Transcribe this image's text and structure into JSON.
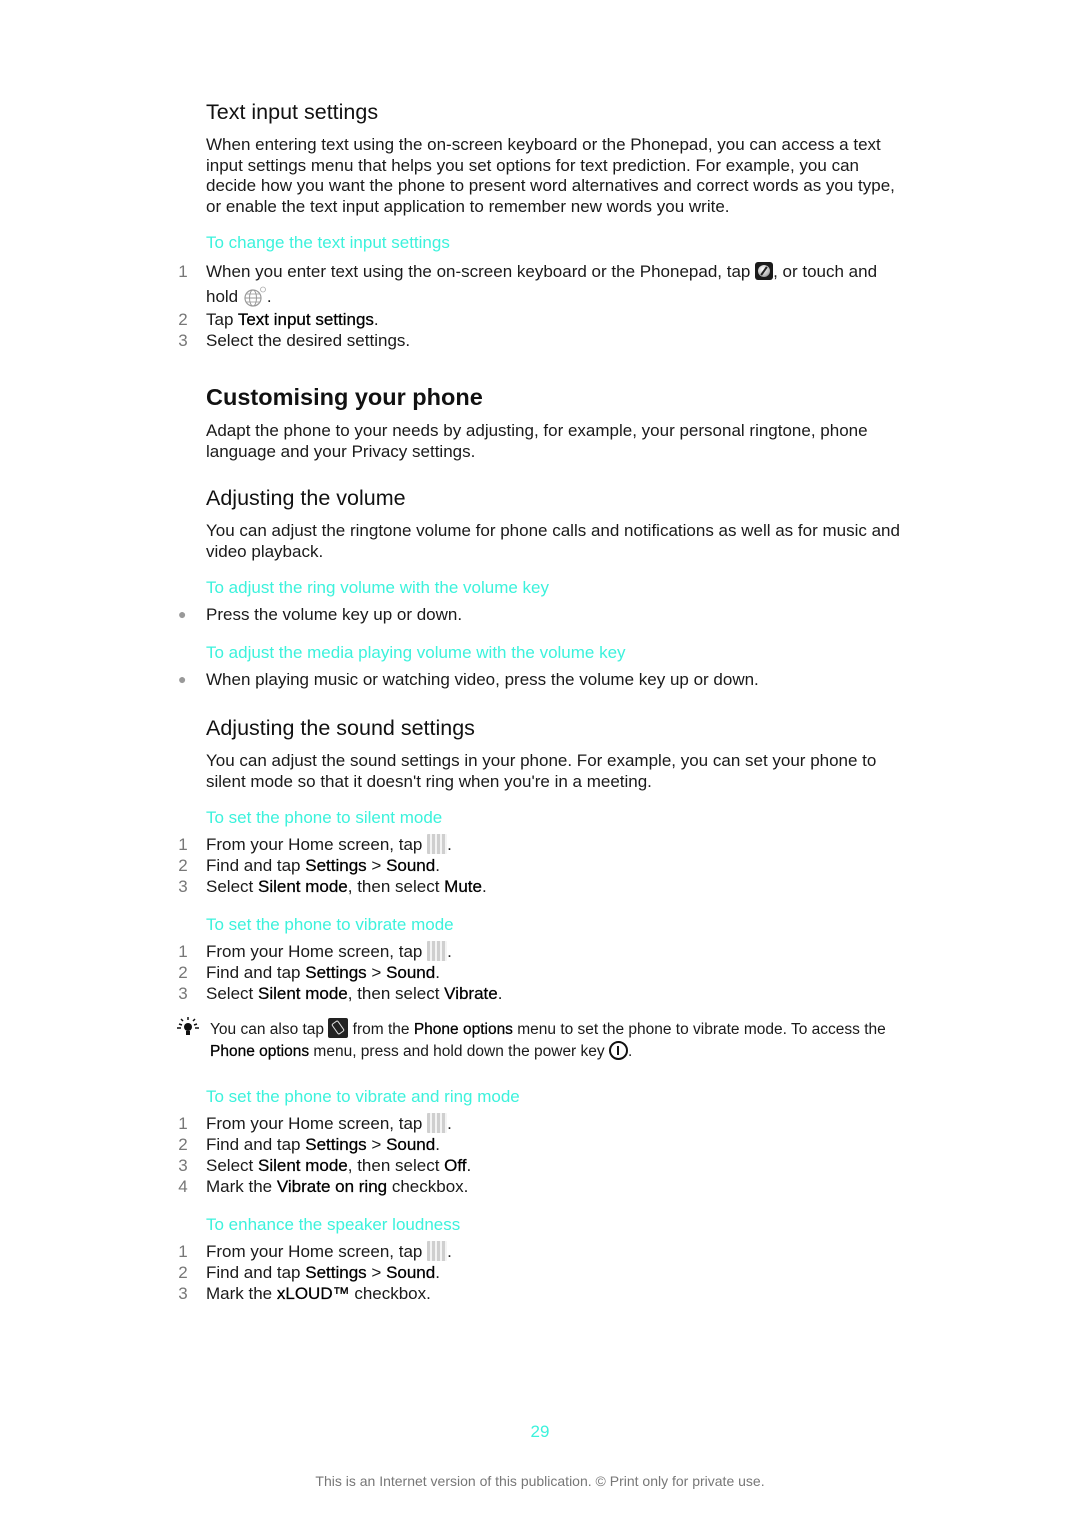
{
  "colors": {
    "task_heading": "#3cf2dc",
    "body_text": "#1a1a1a",
    "step_number": "#777777",
    "footer": "#777777"
  },
  "sections": {
    "text_input": {
      "heading": "Text input settings",
      "body": "When entering text using the on-screen keyboard or the Phonepad, you can access a text input settings menu that helps you set options for text prediction. For example, you can decide how you want the phone to present word alternatives and correct words as you type, or enable the text input application to remember new words you write.",
      "task": {
        "title": "To change the text input settings",
        "steps": [
          {
            "num": "1",
            "parts": [
              {
                "t": "When you enter text using the on-screen keyboard or the Phonepad, tap "
              },
              {
                "icon": "settings-wrench-icon"
              },
              {
                "t": ", or touch and hold "
              },
              {
                "icon": "globe-language-icon"
              },
              {
                "t": "."
              }
            ]
          },
          {
            "num": "2",
            "parts": [
              {
                "t": "Tap "
              },
              {
                "b": "Text input settings"
              },
              {
                "t": "."
              }
            ]
          },
          {
            "num": "3",
            "parts": [
              {
                "t": "Select the desired settings."
              }
            ]
          }
        ]
      }
    },
    "customising": {
      "heading": "Customising your phone",
      "body": "Adapt the phone to your needs by adjusting, for example, your personal ringtone, phone language and your Privacy settings."
    },
    "volume": {
      "heading": "Adjusting the volume",
      "body": "You can adjust the ringtone volume for phone calls and notifications as well as for music and video playback.",
      "tasks": [
        {
          "title": "To adjust the ring volume with the volume key",
          "bullets": [
            "Press the volume key up or down."
          ]
        },
        {
          "title": "To adjust the media playing volume with the volume key",
          "bullets": [
            "When playing music or watching video, press the volume key up or down."
          ]
        }
      ]
    },
    "sound": {
      "heading": "Adjusting the sound settings",
      "body": "You can adjust the sound settings in your phone. For example, you can set your phone to silent mode so that it doesn't ring when you're in a meeting.",
      "tasks": [
        {
          "title": "To set the phone to silent mode",
          "steps": [
            {
              "num": "1",
              "parts": [
                {
                  "t": "From your Home screen, tap "
                },
                {
                  "icon": "application-screen-icon"
                },
                {
                  "t": "."
                }
              ]
            },
            {
              "num": "2",
              "parts": [
                {
                  "t": "Find and tap "
                },
                {
                  "b": "Settings"
                },
                {
                  "t": " > "
                },
                {
                  "b": "Sound"
                },
                {
                  "t": "."
                }
              ]
            },
            {
              "num": "3",
              "parts": [
                {
                  "t": "Select "
                },
                {
                  "b": "Silent mode"
                },
                {
                  "t": ", then select "
                },
                {
                  "b": "Mute"
                },
                {
                  "t": "."
                }
              ]
            }
          ]
        },
        {
          "title": "To set the phone to vibrate mode",
          "steps": [
            {
              "num": "1",
              "parts": [
                {
                  "t": "From your Home screen, tap "
                },
                {
                  "icon": "application-screen-icon"
                },
                {
                  "t": "."
                }
              ]
            },
            {
              "num": "2",
              "parts": [
                {
                  "t": "Find and tap "
                },
                {
                  "b": "Settings"
                },
                {
                  "t": " > "
                },
                {
                  "b": "Sound"
                },
                {
                  "t": "."
                }
              ]
            },
            {
              "num": "3",
              "parts": [
                {
                  "t": "Select "
                },
                {
                  "b": "Silent mode"
                },
                {
                  "t": ", then select "
                },
                {
                  "b": "Vibrate"
                },
                {
                  "t": "."
                }
              ]
            }
          ],
          "tip": {
            "icon": "tip-lightbulb-icon",
            "parts": [
              {
                "t": "You can also tap "
              },
              {
                "icon": "vibrate-mode-icon"
              },
              {
                "t": " from the "
              },
              {
                "b": "Phone options"
              },
              {
                "t": " menu to set the phone to vibrate mode. To access the "
              },
              {
                "b": "Phone options"
              },
              {
                "t": " menu, press and hold down the power key "
              },
              {
                "icon": "power-key-icon"
              },
              {
                "t": "."
              }
            ]
          }
        },
        {
          "title": "To set the phone to vibrate and ring mode",
          "steps": [
            {
              "num": "1",
              "parts": [
                {
                  "t": "From your Home screen, tap "
                },
                {
                  "icon": "application-screen-icon"
                },
                {
                  "t": "."
                }
              ]
            },
            {
              "num": "2",
              "parts": [
                {
                  "t": "Find and tap "
                },
                {
                  "b": "Settings"
                },
                {
                  "t": " > "
                },
                {
                  "b": "Sound"
                },
                {
                  "t": "."
                }
              ]
            },
            {
              "num": "3",
              "parts": [
                {
                  "t": "Select "
                },
                {
                  "b": "Silent mode"
                },
                {
                  "t": ", then select "
                },
                {
                  "b": "Off"
                },
                {
                  "t": "."
                }
              ]
            },
            {
              "num": "4",
              "parts": [
                {
                  "t": "Mark the "
                },
                {
                  "b": "Vibrate on ring"
                },
                {
                  "t": " checkbox."
                }
              ]
            }
          ]
        },
        {
          "title": "To enhance the speaker loudness",
          "steps": [
            {
              "num": "1",
              "parts": [
                {
                  "t": "From your Home screen, tap "
                },
                {
                  "icon": "application-screen-icon"
                },
                {
                  "t": "."
                }
              ]
            },
            {
              "num": "2",
              "parts": [
                {
                  "t": "Find and tap "
                },
                {
                  "b": "Settings"
                },
                {
                  "t": " > "
                },
                {
                  "b": "Sound"
                },
                {
                  "t": "."
                }
              ]
            },
            {
              "num": "3",
              "parts": [
                {
                  "t": "Mark the "
                },
                {
                  "b": "xLOUD™"
                },
                {
                  "t": " checkbox."
                }
              ]
            }
          ]
        }
      ]
    }
  },
  "footer": {
    "page_number": "29",
    "notice": "This is an Internet version of this publication. © Print only for private use."
  }
}
